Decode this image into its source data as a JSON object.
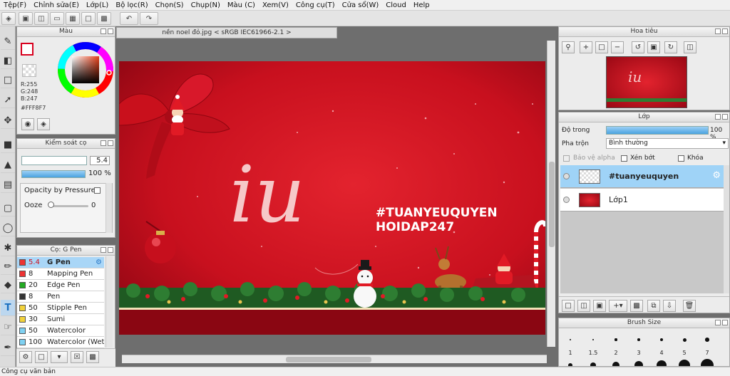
{
  "menu": [
    "Tệp(F)",
    "Chỉnh sửa(E)",
    "Lớp(L)",
    "Bộ lọc(R)",
    "Chọn(S)",
    "Chụp(N)",
    "Màu (C)",
    "Xem(V)",
    "Công cụ(T)",
    "Cửa sổ(W)",
    "Cloud",
    "Help"
  ],
  "color_panel": {
    "title": "Màu",
    "r": "R:255",
    "g": "G:248",
    "b": "B:247",
    "hex": "#FFF8F7",
    "current_color": "#d8001e"
  },
  "brush_control": {
    "title": "Kiểm soát cọ",
    "size_value": "5.4",
    "opacity_value": "100 %",
    "opacity_fraction": 1.0,
    "pressure_label": "Opacity by Pressure",
    "ooze_label": "Ooze",
    "ooze_value": "0"
  },
  "brush_list": {
    "title": "Cọ: G Pen",
    "items": [
      {
        "size": "5.4",
        "name": "G Pen",
        "color": "#ee3333"
      },
      {
        "size": "8",
        "name": "Mapping Pen",
        "color": "#ee3333"
      },
      {
        "size": "20",
        "name": "Edge Pen",
        "color": "#22aa22"
      },
      {
        "size": "8",
        "name": "Pen",
        "color": "#333333"
      },
      {
        "size": "50",
        "name": "Stipple Pen",
        "color": "#f2d23a"
      },
      {
        "size": "30",
        "name": "Sumi",
        "color": "#f2d23a"
      },
      {
        "size": "50",
        "name": "Watercolor",
        "color": "#7fd1f2"
      },
      {
        "size": "100",
        "name": "Watercolor (Wet)",
        "color": "#7fd1f2"
      }
    ]
  },
  "document": {
    "tab_label": "nền noel đỏ.jpg < sRGB IEC61966-2.1 >",
    "canvas_logo": "iu",
    "canvas_line1": "#TUANYEUQUYEN",
    "canvas_line2": "HOIDAP247"
  },
  "navigator": {
    "title": "Hoa tiêu"
  },
  "layers": {
    "title": "Lớp",
    "opacity_label": "Độ trong",
    "opacity_value": "100 %",
    "opacity_fraction": 1.0,
    "blend_label": "Pha trộn",
    "blend_value": "Bình thường",
    "protect_alpha": "Bảo vệ alpha",
    "clipping": "Xén bớt",
    "lock": "Khóa",
    "items": [
      {
        "name": "#tuanyeuquyen",
        "selected": true
      },
      {
        "name": "Lớp1",
        "selected": false
      }
    ]
  },
  "brush_size": {
    "title": "Brush Size",
    "labels": [
      "1",
      "1.5",
      "2",
      "3",
      "4",
      "5",
      "7"
    ]
  },
  "status": {
    "text": "Công cụ văn bản"
  }
}
